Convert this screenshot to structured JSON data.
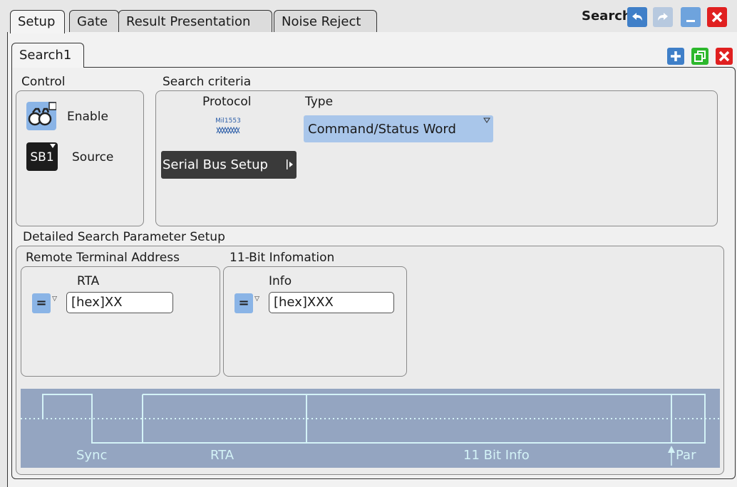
{
  "tabs": [
    {
      "label": "Setup",
      "active": true
    },
    {
      "label": "Gate"
    },
    {
      "label": "Result Presentation"
    },
    {
      "label": "Noise Reject"
    }
  ],
  "window": {
    "title": "Search",
    "buttons": [
      "undo-icon",
      "redo-icon",
      "minimize-icon",
      "close-icon"
    ]
  },
  "search_tab": {
    "label": "Search1"
  },
  "search_buttons": [
    "add-icon",
    "copy-icon",
    "delete-icon"
  ],
  "control": {
    "title": "Control",
    "enable_label": "Enable",
    "source_label": "Source",
    "source_icon_text": "SB1"
  },
  "criteria": {
    "title": "Search criteria",
    "protocol_label": "Protocol",
    "protocol_icon_text": "Mil1553",
    "type_label": "Type",
    "type_value": "Command/Status Word",
    "serial_bus_button": "Serial Bus Setup"
  },
  "detailed": {
    "title": "Detailed Search Parameter Setup",
    "rta_group": {
      "title": "Remote Terminal Address",
      "label": "RTA",
      "operator": "=",
      "value": "[hex]XX"
    },
    "info_group": {
      "title": "11-Bit Infomation",
      "label": "Info",
      "operator": "=",
      "value": "[hex]XXX"
    }
  },
  "waveform": {
    "labels": [
      "Sync",
      "RTA",
      "11 Bit Info",
      "Par"
    ],
    "colors": {
      "background": "#94a5c1",
      "trace": "#d4f3f7"
    }
  },
  "colors": {
    "accent_blue": "#4a90d9",
    "add_green": "#2db82d",
    "close_red": "#e02020"
  }
}
